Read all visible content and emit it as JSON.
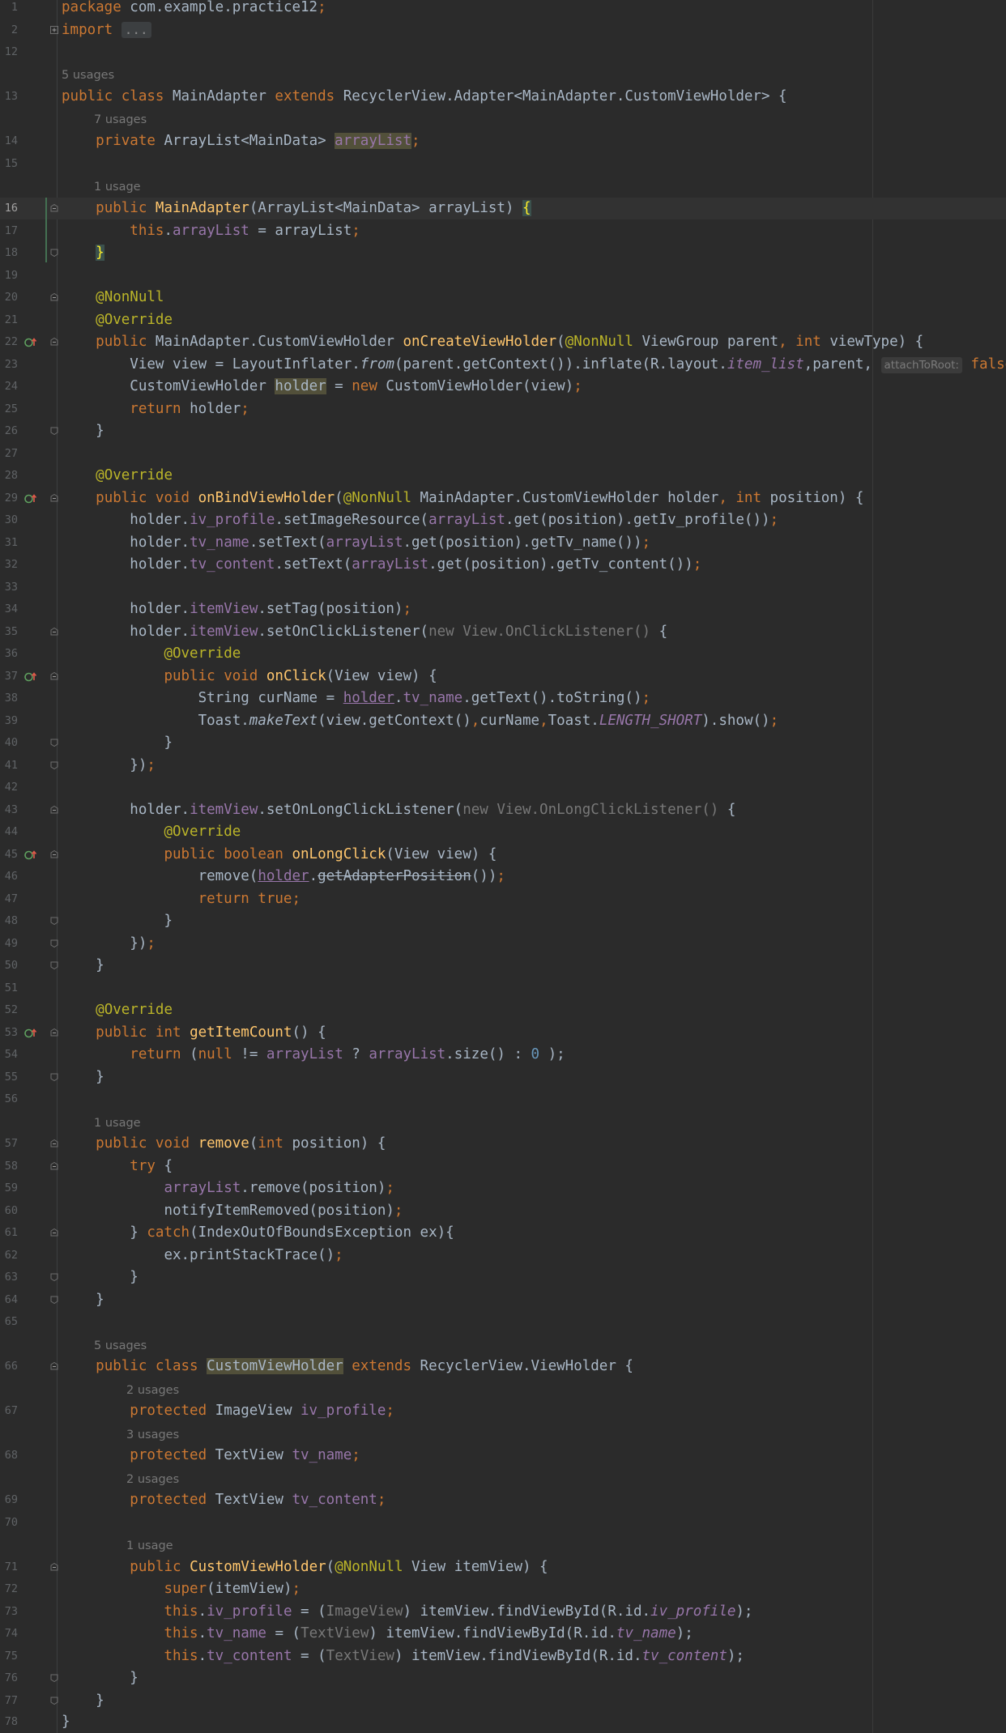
{
  "editor": {
    "file_language": "java",
    "colors": {
      "background": "#2b2b2b",
      "keyword": "#cc7832",
      "field": "#9876aa",
      "method": "#ffc66d",
      "annotation": "#bbb529",
      "number": "#6897bb",
      "text": "#a9b7c6"
    }
  },
  "lines": {
    "l1": {
      "ln": "1",
      "a": "package ",
      "b": "com.example.practice12",
      "c": ";"
    },
    "l2": {
      "ln": "2",
      "a": "import ",
      "b": "..."
    },
    "l12": {
      "ln": "12"
    },
    "u13": "5 usages",
    "l13": {
      "ln": "13",
      "a": "public class ",
      "b": "MainAdapter ",
      "c": "extends ",
      "d": "RecyclerView.Adapter<MainAdapter.CustomViewHolder> {"
    },
    "u14": "7 usages",
    "l14": {
      "ln": "14",
      "a": "private ",
      "b": "ArrayList<MainData> ",
      "c": "arrayList",
      "d": ";"
    },
    "l15": {
      "ln": "15"
    },
    "u16": "1 usage",
    "l16": {
      "ln": "16",
      "a": "public ",
      "b": "MainAdapter",
      "c": "(ArrayList<MainData> arrayList) ",
      "d": "{"
    },
    "l17": {
      "ln": "17",
      "a": "this",
      "b": ".",
      "c": "arrayList",
      "d": " = arrayList",
      "e": ";"
    },
    "l18": {
      "ln": "18",
      "a": "}"
    },
    "l19": {
      "ln": "19"
    },
    "l20": {
      "ln": "20",
      "a": "@NonNull"
    },
    "l21": {
      "ln": "21",
      "a": "@Override"
    },
    "l22": {
      "ln": "22",
      "a": "public ",
      "b": "MainAdapter.CustomViewHolder ",
      "c": "onCreateViewHolder",
      "d": "(",
      "e": "@NonNull ",
      "f": "ViewGroup parent",
      "g": ", ",
      "h": "int ",
      "i": "viewType) {"
    },
    "l23": {
      "ln": "23",
      "a": "View view = LayoutInflater.",
      "b": "from",
      "c": "(parent.getContext()).inflate(R.layout.",
      "d": "item_list",
      "e": ",parent, ",
      "hint": "attachToRoot:",
      "f": " false",
      "g": ");"
    },
    "l24": {
      "ln": "24",
      "a": "CustomViewHolder ",
      "b": "holder",
      "c": " = ",
      "d": "new ",
      "e": "CustomViewHolder(view)",
      "f": ";"
    },
    "l25": {
      "ln": "25",
      "a": "return ",
      "b": "holder",
      "c": ";"
    },
    "l26": {
      "ln": "26",
      "a": "}"
    },
    "l27": {
      "ln": "27"
    },
    "l28": {
      "ln": "28",
      "a": "@Override"
    },
    "l29": {
      "ln": "29",
      "a": "public void ",
      "b": "onBindViewHolder",
      "c": "(",
      "d": "@NonNull ",
      "e": "MainAdapter.CustomViewHolder holder",
      "f": ", ",
      "g": "int ",
      "h": "position) {"
    },
    "l30": {
      "ln": "30",
      "a": "holder.",
      "b": "iv_profile",
      "c": ".setImageResource(",
      "d": "arrayList",
      "e": ".get(position).getIv_profile())",
      "f": ";"
    },
    "l31": {
      "ln": "31",
      "a": "holder.",
      "b": "tv_name",
      "c": ".setText(",
      "d": "arrayList",
      "e": ".get(position).getTv_name())",
      "f": ";"
    },
    "l32": {
      "ln": "32",
      "a": "holder.",
      "b": "tv_content",
      "c": ".setText(",
      "d": "arrayList",
      "e": ".get(position).getTv_content())",
      "f": ";"
    },
    "l33": {
      "ln": "33"
    },
    "l34": {
      "ln": "34",
      "a": "holder.",
      "b": "itemView",
      "c": ".setTag(position)",
      "d": ";"
    },
    "l35": {
      "ln": "35",
      "a": "holder.",
      "b": "itemView",
      "c": ".setOnClickListener(",
      "d": "new View.OnClickListener() ",
      "e": "{"
    },
    "l36": {
      "ln": "36",
      "a": "@Override"
    },
    "l37": {
      "ln": "37",
      "a": "public void ",
      "b": "onClick",
      "c": "(View view) {"
    },
    "l38": {
      "ln": "38",
      "a": "String curName = ",
      "b": "holder",
      "c": ".",
      "d": "tv_name",
      "e": ".getText().toString()",
      "f": ";"
    },
    "l39": {
      "ln": "39",
      "a": "Toast.",
      "b": "makeText",
      "c": "(view.getContext()",
      "d": ",",
      "e": "curName",
      "f": ",",
      "g": "Toast.",
      "h": "LENGTH_SHORT",
      "i": ").show()",
      "j": ";"
    },
    "l40": {
      "ln": "40",
      "a": "}"
    },
    "l41": {
      "ln": "41",
      "a": "})",
      "b": ";"
    },
    "l42": {
      "ln": "42"
    },
    "l43": {
      "ln": "43",
      "a": "holder.",
      "b": "itemView",
      "c": ".setOnLongClickListener(",
      "d": "new View.OnLongClickListener() ",
      "e": "{"
    },
    "l44": {
      "ln": "44",
      "a": "@Override"
    },
    "l45": {
      "ln": "45",
      "a": "public boolean ",
      "b": "onLongClick",
      "c": "(View view) {"
    },
    "l46": {
      "ln": "46",
      "a": "remove(",
      "b": "holder",
      "c": ".",
      "d": "getAdapterPosition",
      "e": "())",
      "f": ";"
    },
    "l47": {
      "ln": "47",
      "a": "return true",
      "b": ";"
    },
    "l48": {
      "ln": "48",
      "a": "}"
    },
    "l49": {
      "ln": "49",
      "a": "})",
      "b": ";"
    },
    "l50": {
      "ln": "50",
      "a": "}"
    },
    "l51": {
      "ln": "51"
    },
    "l52": {
      "ln": "52",
      "a": "@Override"
    },
    "l53": {
      "ln": "53",
      "a": "public int ",
      "b": "getItemCount",
      "c": "() {"
    },
    "l54": {
      "ln": "54",
      "a": "return ",
      "b": "(",
      "c": "null ",
      "d": "!= ",
      "e": "arrayList",
      "f": " ? ",
      "g": "arrayList",
      "h": ".size() : ",
      "i": "0",
      "j": " );"
    },
    "l55": {
      "ln": "55",
      "a": "}"
    },
    "l56": {
      "ln": "56"
    },
    "u57": "1 usage",
    "l57": {
      "ln": "57",
      "a": "public void ",
      "b": "remove",
      "c": "(",
      "d": "int ",
      "e": "position) {"
    },
    "l58": {
      "ln": "58",
      "a": "try ",
      "b": "{"
    },
    "l59": {
      "ln": "59",
      "a": "arrayList",
      "b": ".remove(position)",
      "c": ";"
    },
    "l60": {
      "ln": "60",
      "a": "notifyItemRemoved(position)",
      "b": ";"
    },
    "l61": {
      "ln": "61",
      "a": "} ",
      "b": "catch",
      "c": "(IndexOutOfBoundsException ex){"
    },
    "l62": {
      "ln": "62",
      "a": "ex.printStackTrace()",
      "b": ";"
    },
    "l63": {
      "ln": "63",
      "a": "}"
    },
    "l64": {
      "ln": "64",
      "a": "}"
    },
    "l65": {
      "ln": "65"
    },
    "u66": "5 usages",
    "l66": {
      "ln": "66",
      "a": "public class ",
      "b": "CustomViewHolder",
      "c": " ",
      "d": "extends ",
      "e": "RecyclerView.ViewHolder {"
    },
    "u67": "2 usages",
    "l67": {
      "ln": "67",
      "a": "protected ",
      "b": "ImageView ",
      "c": "iv_profile",
      "d": ";"
    },
    "u68": "3 usages",
    "l68": {
      "ln": "68",
      "a": "protected ",
      "b": "TextView ",
      "c": "tv_name",
      "d": ";"
    },
    "u69": "2 usages",
    "l69": {
      "ln": "69",
      "a": "protected ",
      "b": "TextView ",
      "c": "tv_content",
      "d": ";"
    },
    "l70": {
      "ln": "70"
    },
    "u71": "1 usage",
    "l71": {
      "ln": "71",
      "a": "public ",
      "b": "CustomViewHolder",
      "c": "(",
      "d": "@NonNull ",
      "e": "View itemView) {"
    },
    "l72": {
      "ln": "72",
      "a": "super",
      "b": "(itemView)",
      "c": ";"
    },
    "l73": {
      "ln": "73",
      "a": "this",
      "b": ".",
      "c": "iv_profile",
      "d": " = (",
      "e": "ImageView",
      "f": ") itemView.findViewById(R.id.",
      "g": "iv_profile",
      "h": ");"
    },
    "l74": {
      "ln": "74",
      "a": "this",
      "b": ".",
      "c": "tv_name",
      "d": " = (",
      "e": "TextView",
      "f": ") itemView.findViewById(R.id.",
      "g": "tv_name",
      "h": ");"
    },
    "l75": {
      "ln": "75",
      "a": "this",
      "b": ".",
      "c": "tv_content",
      "d": " = (",
      "e": "TextView",
      "f": ") itemView.findViewById(R.id.",
      "g": "tv_content",
      "h": ");"
    },
    "l76": {
      "ln": "76",
      "a": "}"
    },
    "l77": {
      "ln": "77",
      "a": "}"
    },
    "l78": {
      "ln": "78",
      "a": "}"
    }
  }
}
